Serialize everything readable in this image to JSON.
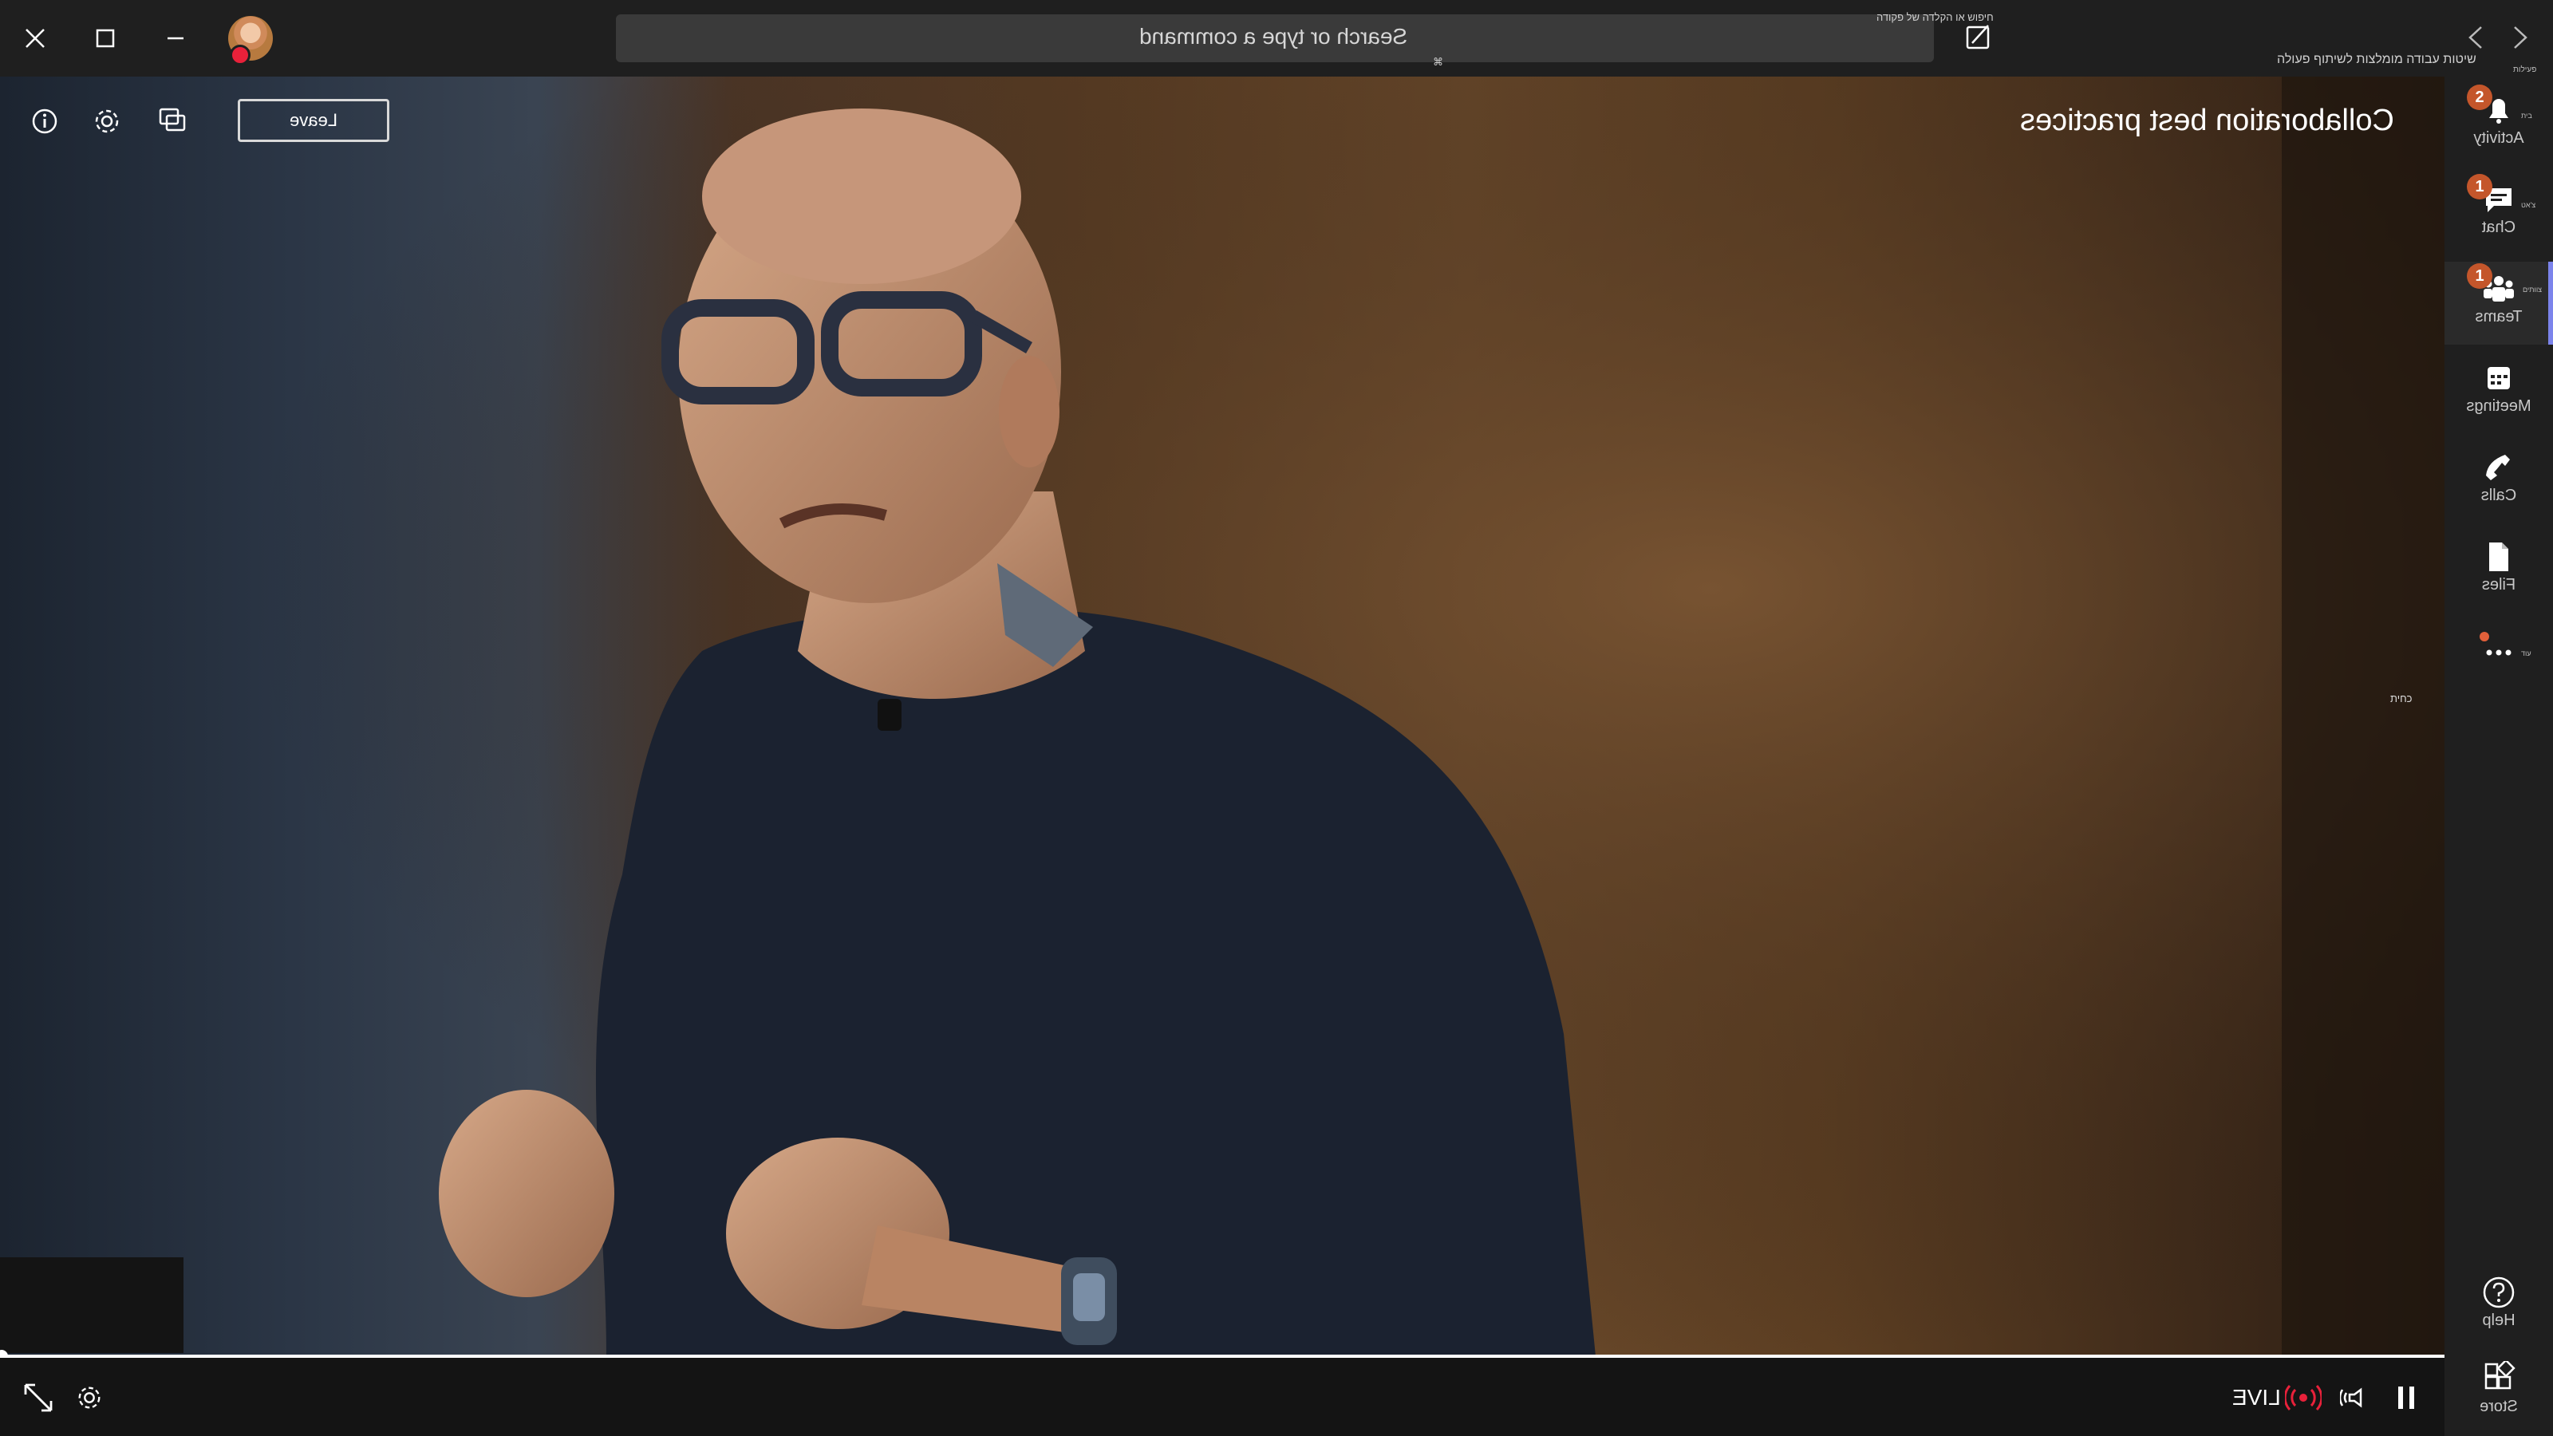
{
  "window": {
    "search_placeholder": "Search or type a command",
    "search_hint_he": "חיפוש או הקלדה של פקודה",
    "search_shortcut_tiny": "⌘",
    "workspace_hint_he": "שיטות עבודה מומלצות לשיתוף פעולה",
    "nav_tiny": "פעילות"
  },
  "event": {
    "title": "Collaboration best practices",
    "leave_label": "Leave",
    "side_tiny": "כחית"
  },
  "player": {
    "live_label": "LIVE",
    "progress": 0.0
  },
  "rail": {
    "items": [
      {
        "label": "Activity",
        "badge": "2",
        "icon": "bell-icon"
      },
      {
        "label": "Chat",
        "badge": "1",
        "icon": "chat-icon"
      },
      {
        "label": "Teams",
        "badge": "1",
        "icon": "teams-icon",
        "active": true
      },
      {
        "label": "Meetings",
        "badge": "",
        "icon": "calendar-icon"
      },
      {
        "label": "Calls",
        "badge": "",
        "icon": "phone-icon"
      },
      {
        "label": "Files",
        "badge": "",
        "icon": "file-icon"
      },
      {
        "label": "",
        "badge": "",
        "icon": "more-icon"
      }
    ],
    "bottom": [
      {
        "label": "Help",
        "icon": "help-icon"
      },
      {
        "label": "Store",
        "icon": "store-icon"
      }
    ],
    "tiny_activity": "בית",
    "tiny_chat": "צ'אט",
    "tiny_teams": "צוותים",
    "tiny_more": "עוד"
  },
  "colors": {
    "accent": "#7b83eb",
    "badge": "#c4562b",
    "live_red": "#e8213a"
  }
}
